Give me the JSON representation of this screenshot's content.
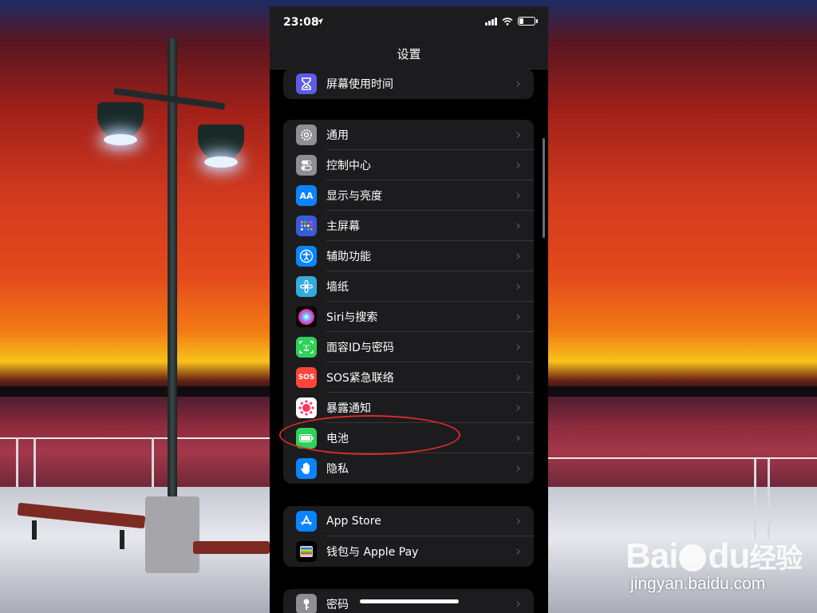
{
  "status_bar": {
    "time": "23:08"
  },
  "nav": {
    "title": "设置"
  },
  "groups": [
    {
      "items": [
        {
          "label": "屏幕使用时间",
          "icon": "hourglass-icon",
          "color": "#5e5ce6"
        }
      ]
    },
    {
      "items": [
        {
          "label": "通用",
          "icon": "gear-icon",
          "color": "#8e8e93"
        },
        {
          "label": "控制中心",
          "icon": "toggles-icon",
          "color": "#8e8e93"
        },
        {
          "label": "显示与亮度",
          "icon": "text-size-icon",
          "color": "#0a84ff"
        },
        {
          "label": "主屏幕",
          "icon": "grid-icon",
          "color": "#3a5bd9"
        },
        {
          "label": "辅助功能",
          "icon": "accessibility-icon",
          "color": "#0a84ff"
        },
        {
          "label": "墙纸",
          "icon": "flower-icon",
          "color": "#35aadc"
        },
        {
          "label": "Siri与搜索",
          "icon": "siri-icon",
          "color": "#1c1c1e"
        },
        {
          "label": "面容ID与密码",
          "icon": "face-id-icon",
          "color": "#30d158"
        },
        {
          "label": "SOS紧急联络",
          "icon": "sos-icon",
          "color": "#ff453a"
        },
        {
          "label": "暴露通知",
          "icon": "exposure-icon",
          "color": "#ffffff"
        },
        {
          "label": "电池",
          "icon": "battery-icon",
          "color": "#30d158"
        },
        {
          "label": "隐私",
          "icon": "hand-icon",
          "color": "#0a84ff"
        }
      ]
    },
    {
      "items": [
        {
          "label": "App Store",
          "icon": "app-store-icon",
          "color": "#0a84ff"
        },
        {
          "label": "钱包与 Apple Pay",
          "icon": "wallet-icon",
          "color": "#2c2c2e"
        }
      ]
    },
    {
      "items": [
        {
          "label": "密码",
          "icon": "key-icon",
          "color": "#8e8e93"
        }
      ]
    }
  ],
  "icon_glyphs": {
    "sos": "SOS",
    "text_size": "AA"
  },
  "watermark": {
    "logo": "Bai",
    "logo_tail": "du",
    "logo_cn": "经验",
    "url": "jingyan.baidu.com"
  }
}
